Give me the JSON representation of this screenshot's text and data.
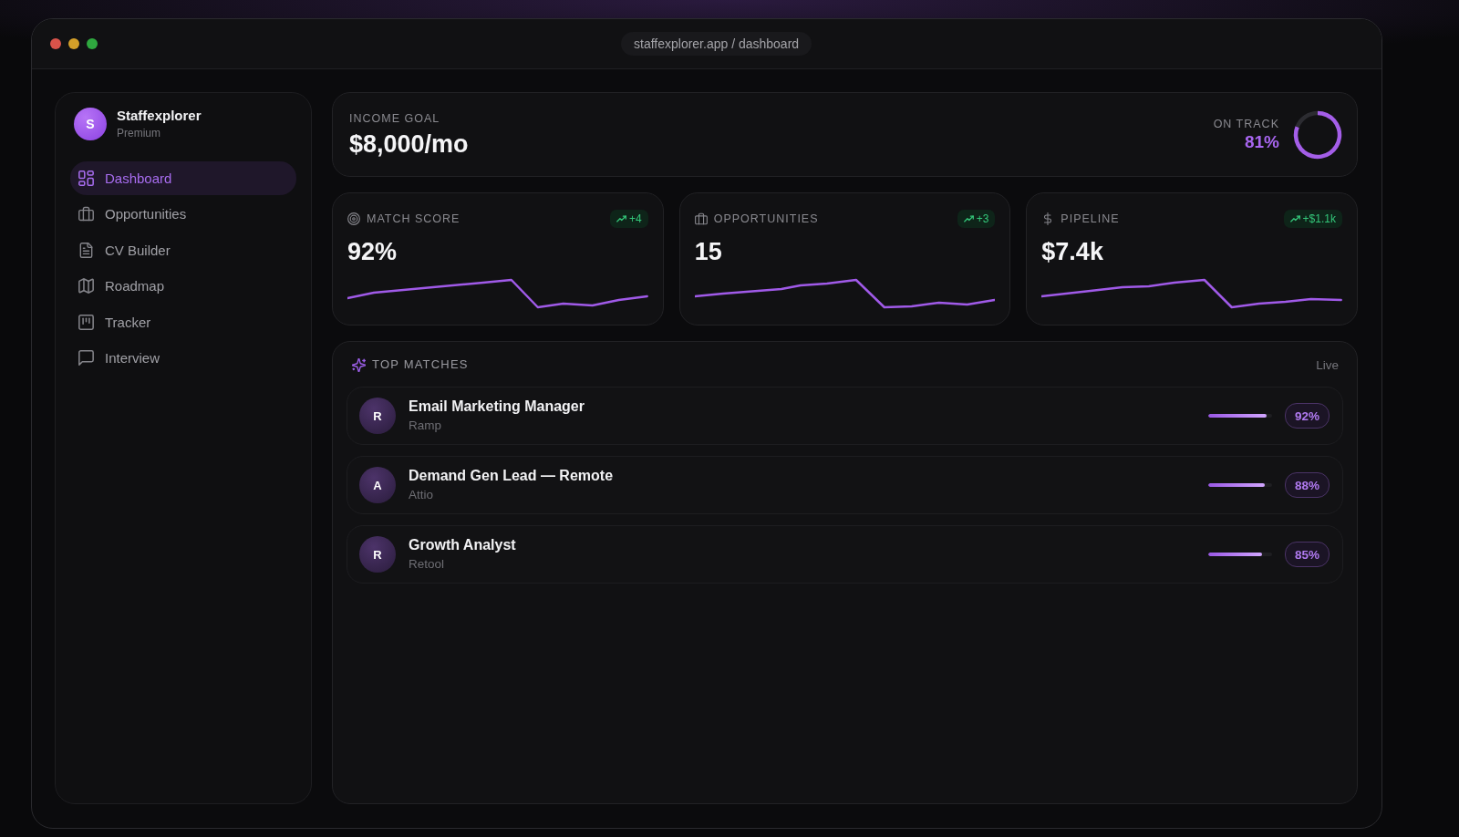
{
  "window": {
    "url": "staffexplorer.app / dashboard"
  },
  "sidebar": {
    "brand": {
      "initial": "S",
      "name": "Staffexplorer",
      "plan": "Premium"
    },
    "items": [
      {
        "label": "Dashboard",
        "selected": true
      },
      {
        "label": "Opportunities",
        "selected": false
      },
      {
        "label": "CV Builder",
        "selected": false
      },
      {
        "label": "Roadmap",
        "selected": false
      },
      {
        "label": "Tracker",
        "selected": false
      },
      {
        "label": "Interview",
        "selected": false
      }
    ]
  },
  "income_goal": {
    "label": "INCOME GOAL",
    "value": "$8,000/mo",
    "status": "ON TRACK",
    "percent": "81%",
    "chart_data": {
      "type": "donut",
      "values": [
        81,
        19
      ],
      "colors": [
        "#a45ee8",
        "#2c2c31"
      ]
    }
  },
  "stats": [
    {
      "label": "MATCH SCORE",
      "value": "92%",
      "delta": "+4"
    },
    {
      "label": "OPPORTUNITIES",
      "value": "15",
      "delta": "+3"
    },
    {
      "label": "PIPELINE",
      "value": "$7.4k",
      "delta": "+$1.1k"
    }
  ],
  "top_matches": {
    "title": "TOP MATCHES",
    "status": "Live",
    "rows": [
      {
        "initial": "R",
        "title": "Email Marketing Manager",
        "company": "Ramp",
        "level": 0.92,
        "score": "92%"
      },
      {
        "initial": "A",
        "title": "Demand Gen Lead — Remote",
        "company": "Attio",
        "level": 0.88,
        "score": "88%"
      },
      {
        "initial": "R",
        "title": "Growth Analyst",
        "company": "Retool",
        "level": 0.85,
        "score": "85%"
      }
    ]
  }
}
